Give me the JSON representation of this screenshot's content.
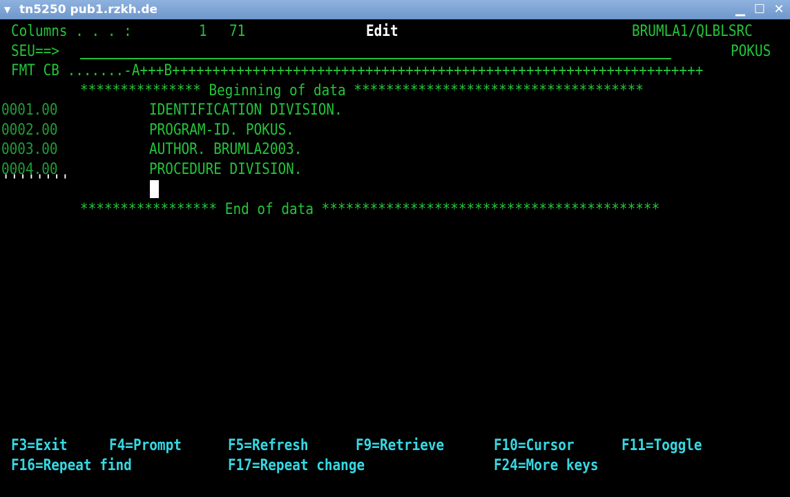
{
  "window": {
    "title": "tn5250 pub1.rzkh.de",
    "menu_icon": "triangle-down-icon",
    "minimize_icon": "minimize-icon",
    "maximize_icon": "maximize-icon",
    "close_icon": "close-icon"
  },
  "header": {
    "columns_label": "Columns . . . :",
    "columns_from": "1",
    "columns_to": "71",
    "mode": "Edit",
    "file": "BRUMLA1/QLBLSRC",
    "seu_prompt": "SEU==>",
    "member": "POKUS",
    "format_line": "FMT CB .......-A+++B++++++++++++++++++++++++++++++++++++++++++++++++++++++++++++++++++"
  },
  "source": {
    "begin_marker": "*************** Beginning of data ************************************",
    "end_marker": "***************** End of data ******************************************",
    "lines": [
      {
        "seq": "0001.00",
        "text": "IDENTIFICATION DIVISION."
      },
      {
        "seq": "0002.00",
        "text": "PROGRAM-ID. POKUS."
      },
      {
        "seq": "0003.00",
        "text": "AUTHOR. BRUMLA2003."
      },
      {
        "seq": "0004.00",
        "text": "PROCEDURE DIVISION."
      }
    ],
    "insert_line_marker": "''''''''"
  },
  "function_keys": [
    {
      "label": "F3=Exit"
    },
    {
      "label": "F4=Prompt"
    },
    {
      "label": "F5=Refresh"
    },
    {
      "label": "F9=Retrieve"
    },
    {
      "label": "F10=Cursor"
    },
    {
      "label": "F11=Toggle"
    },
    {
      "label": "F16=Repeat find"
    },
    {
      "label": "F17=Repeat change"
    },
    {
      "label": "F24=More keys"
    }
  ],
  "colors": {
    "title_bar": "#7fa5d5",
    "text_green": "#24c43a",
    "text_white": "#ffffff",
    "text_cyan": "#36d8e3",
    "background": "#000000"
  }
}
